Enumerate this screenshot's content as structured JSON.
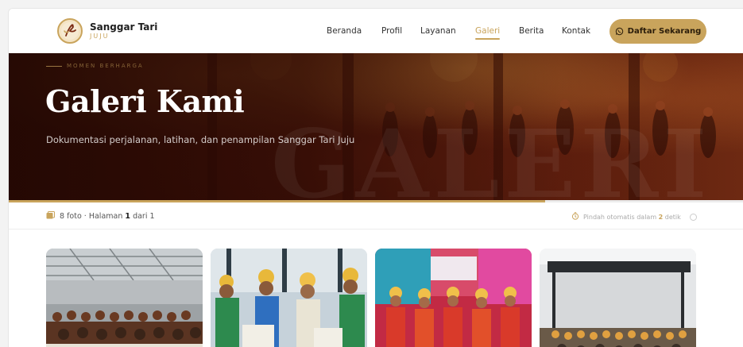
{
  "brand": {
    "name": "Sanggar Tari",
    "subtitle": "JUJU"
  },
  "nav": {
    "items": [
      {
        "label": "Beranda",
        "active": false
      },
      {
        "label": "Profil",
        "active": false
      },
      {
        "label": "Layanan",
        "active": false
      },
      {
        "label": "Galeri",
        "active": true
      },
      {
        "label": "Berita",
        "active": false
      },
      {
        "label": "Kontak",
        "active": false
      }
    ],
    "cta_label": "Daftar Sekarang",
    "cta_icon": "whatsapp-icon"
  },
  "hero": {
    "eyebrow": "MOMEN BERHARGA",
    "title": "Galeri Kami",
    "subtitle": "Dokumentasi perjalanan, latihan, dan penampilan Sanggar Tari Juju",
    "watermark": "GALERI",
    "slide_progress": 0.73
  },
  "info": {
    "photo_count": "8 foto",
    "page_prefix": "Halaman",
    "page_current": "1",
    "page_separator": "dari",
    "page_total": "1",
    "auto_prefix": "Pindah otomatis dalam",
    "auto_seconds": "2",
    "auto_suffix": "detik"
  },
  "gallery": {
    "photos": [
      {
        "subject": "group photo in hall"
      },
      {
        "subject": "dancers holding certificates"
      },
      {
        "subject": "dancers in red costumes"
      },
      {
        "subject": "outdoor stage performance"
      }
    ]
  },
  "colors": {
    "accent": "#c9a45c",
    "hero_dark": "#3a0f06",
    "text": "#2a2a2a"
  }
}
